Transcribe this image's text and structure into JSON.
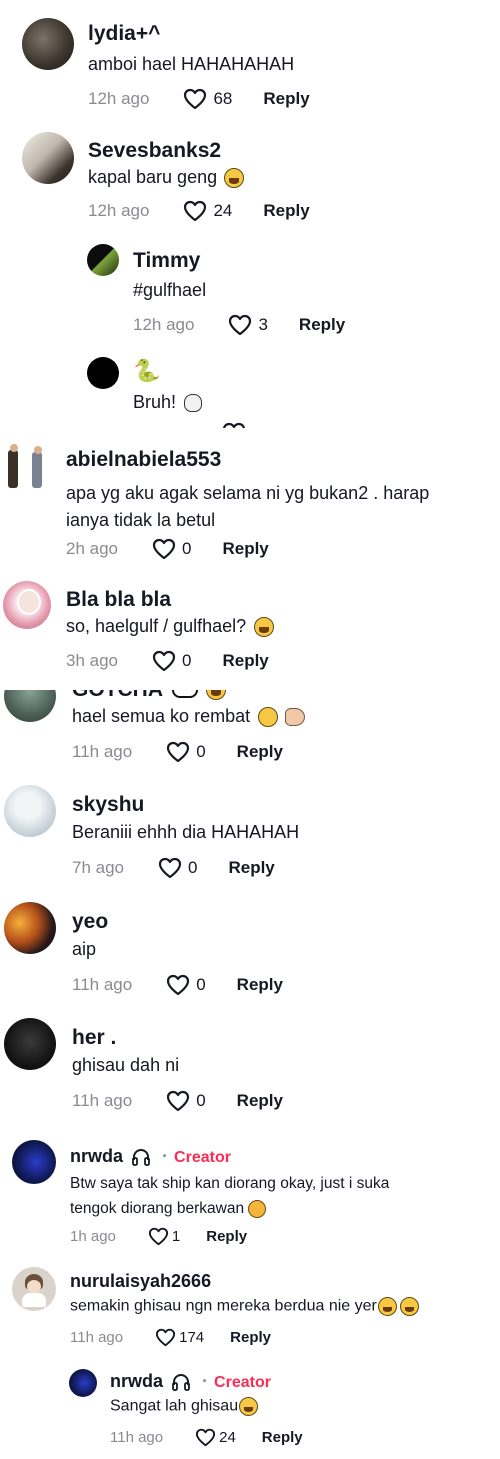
{
  "reply_label": "Reply",
  "comments": {
    "c1": {
      "username": "lydia+^",
      "text": "amboi hael HAHAHAHAH",
      "time": "12h ago",
      "likes": "68"
    },
    "c2": {
      "username": "Sevesbanks2",
      "text": "kapal baru geng",
      "time": "12h ago",
      "likes": "24"
    },
    "c3": {
      "username": "Timmy",
      "text": "#gulfhael",
      "time": "12h ago",
      "likes": "3"
    },
    "c4": {
      "username": "🐍",
      "text": "Bruh!"
    },
    "c5": {
      "username": "abielnabiela553",
      "text_line1": "apa yg aku agak selama ni yg bukan2 . harap",
      "text_line2": "ianya tidak la betul",
      "time": "2h ago",
      "likes": "0"
    },
    "c6": {
      "username": "Bla bla bla",
      "text": "so, haelgulf / gulfhael?",
      "time": "3h ago",
      "likes": "0"
    },
    "c7": {
      "username": "GOTCHA",
      "text": "hael semua ko rembat",
      "time": "11h ago",
      "likes": "0"
    },
    "c8": {
      "username": "skyshu",
      "text": "Beraniii ehhh dia HAHAHAH",
      "time": "7h ago",
      "likes": "0"
    },
    "c9": {
      "username": "yeo",
      "text": "aip",
      "time": "11h ago",
      "likes": "0"
    },
    "c10": {
      "username": "her .",
      "text": "ghisau dah ni",
      "time": "11h ago",
      "likes": "0"
    },
    "c11": {
      "username": "nrwda",
      "badge": "Creator",
      "text_line1": "Btw saya tak ship kan diorang okay, just i suka",
      "text_line2": "tengok diorang berkawan",
      "time": "1h ago",
      "likes": "1"
    },
    "c12": {
      "username": "nurulaisyah2666",
      "text": "semakin ghisau ngn mereka berdua nie yer",
      "time": "11h ago",
      "likes": "174"
    },
    "c13": {
      "username": "nrwda",
      "badge": "Creator",
      "text": "Sangat lah ghisau",
      "time": "11h ago",
      "likes": "24"
    }
  },
  "colors": {
    "creator": "#fe2c55",
    "time": "#8a8b91",
    "text": "#161823"
  }
}
